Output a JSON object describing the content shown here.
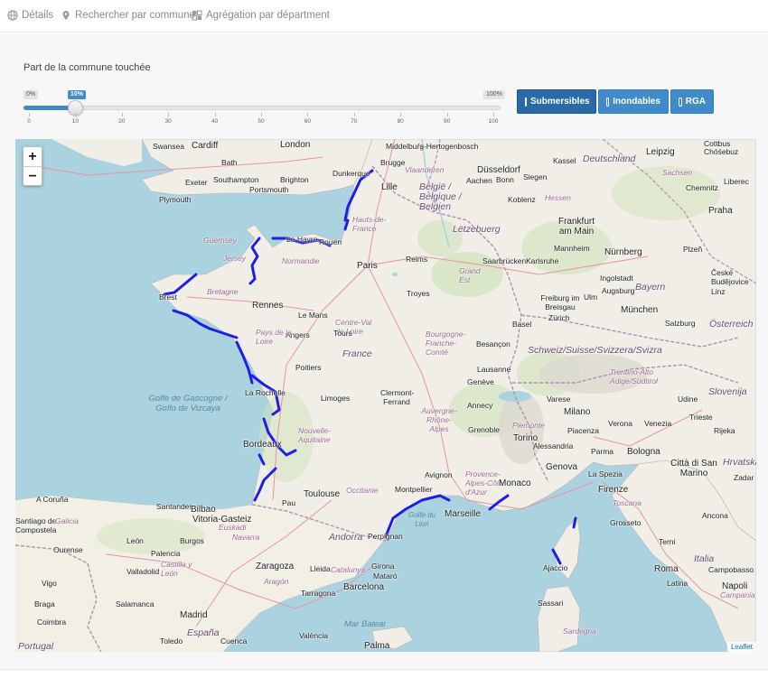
{
  "nav": {
    "tabs": [
      {
        "label": "Détails",
        "icon": "globe-icon"
      },
      {
        "label": "Rechercher par commune",
        "icon": "map-marker-icon"
      },
      {
        "label": "Agrégation par départment",
        "icon": "grid-icon"
      }
    ]
  },
  "slider": {
    "label": "Part de la commune touchée",
    "min_label": "0%",
    "max_label": "100%",
    "current_label": "10%",
    "value_percent": 10,
    "ticks": [
      "0",
      "10",
      "20",
      "30",
      "40",
      "50",
      "60",
      "70",
      "80",
      "90",
      "100"
    ]
  },
  "toggles": [
    {
      "label": "Submersibles",
      "checked": true
    },
    {
      "label": "Inondables",
      "checked": false
    },
    {
      "label": "RGA",
      "checked": false
    }
  ],
  "map": {
    "zoom_in": "+",
    "zoom_out": "−",
    "attribution": "Leaflet",
    "labels": {
      "swansea": "Swansea",
      "cardiff": "Cardiff",
      "london": "London",
      "bath": "Bath",
      "exeter": "Exeter",
      "southampton": "Southampton",
      "portsmouth": "Portsmouth",
      "brighton": "Brighton",
      "plymouth": "Plymouth",
      "middelburg": "Middelburg",
      "hertogenbosch": "'s-Hertogenbosch",
      "brugge": "Brugge",
      "vlaanderen": "Vlaanderen",
      "dunkerque": "Dunkerque",
      "lille": "Lille",
      "belgique": "België / Belgique / Belgien",
      "dusseldorf": "Düsseldorf",
      "aachen": "Aachen",
      "bonn": "Bonn",
      "siegen": "Siegen",
      "koblenz": "Koblenz",
      "kassel": "Kassel",
      "deutschland": "Deutschland",
      "leipzig": "Leipzig",
      "cottbus": "Cottbus Chóśebuz",
      "sachsen": "Sachsen",
      "chemnitz": "Chemnitz",
      "liberec": "Liberec",
      "frankfurt": "Frankfurt am Main",
      "hessen": "Hessen",
      "praha": "Praha",
      "letzebuerg": "Lëtzebuerg",
      "mannheim": "Mannheim",
      "nurnberg": "Nürnberg",
      "plzen": "Plzeň",
      "saarbrucken": "Saarbrücken",
      "karlsruhe": "Karlsruhe",
      "guernsey": "Guernsey",
      "jersey": "Jersey",
      "lehavre": "Le Havre",
      "rouen": "Rouen",
      "hautsdefrance": "Hauts-de-France",
      "normandie": "Normandie",
      "paris": "Paris",
      "reims": "Reims",
      "ingolstadt": "Ingolstadt",
      "bayern": "Bayern",
      "ceske": "České Budějovice",
      "brest": "Brest",
      "bretagne": "Bretagne",
      "rennes": "Rennes",
      "lemans": "Le Mans",
      "troyes": "Troyes",
      "grandest": "Grand Est",
      "freiburg": "Freiburg im Breisgau",
      "ulm": "Ulm",
      "augsburg": "Augsburg",
      "munchen": "München",
      "linz": "Linz",
      "angers": "Angers",
      "centre": "Centre-Val de Loire",
      "paysdelaloire": "Pays de la Loire",
      "basel": "Basel",
      "zurich": "Zürich",
      "salzburg": "Salzburg",
      "osterreich": "Österreich",
      "tours": "Tours",
      "bourgogne": "Bourgogne-Franche-Comté",
      "besancon": "Besançon",
      "france": "France",
      "schweiz": "Schweiz/Suisse/Svizzera/Svizra",
      "poitiers": "Poitiers",
      "lausanne": "Lausanne",
      "trentino": "Trentino-Alto Adige/Südtirol",
      "golfe": "Golfe de Gascogne / Golfo de Vizcaya",
      "larochelle": "La Rochelle",
      "limoges": "Limoges",
      "clermont": "Clermont-Ferrand",
      "geneve": "Genève",
      "varese": "Varese",
      "udine": "Udine",
      "slovenija": "Slovenija",
      "annecy": "Annecy",
      "auvergne": "Auvergne-Rhône-Alpes",
      "milano": "Milano",
      "verona": "Verona",
      "venezia": "Venezia",
      "trieste": "Trieste",
      "nouvelleaquitaine": "Nouvelle-Aquitaine",
      "grenoble": "Grenoble",
      "piemonte": "Piemonte",
      "torino": "Torino",
      "piacenza": "Piacenza",
      "rijeka": "Rijeka",
      "bordeaux": "Bordeaux",
      "alessandria": "Alessandria",
      "parma": "Parma",
      "bologna": "Bologna",
      "hrvatska": "Hrvatska",
      "avignon": "Avignon",
      "provence": "Provence-Alpes-Côte d'Azur",
      "genova": "Genova",
      "lasperzia": "La Spezia",
      "cittasanmarino": "Città di San Marino",
      "zadar": "Zadar",
      "acoruna": "A Coruña",
      "pau": "Pau",
      "toulouse": "Toulouse",
      "occitanie": "Occitanie",
      "montpellier": "Montpellier",
      "monaco": "Monaco",
      "firenze": "Firenze",
      "toscana": "Toscana",
      "santiago": "Santiago de Compostela",
      "galicia": "Galicia",
      "santander": "Santander",
      "bilbao": "Bilbao",
      "vitoria": "Vitoria-Gasteiz",
      "marseille": "Marseille",
      "golfedulion": "Golfe du Lion",
      "grosseto": "Grosseto",
      "ancona": "Ancona",
      "euskadi": "Euskadi",
      "navarra": "Navarra",
      "andorra": "Andorra",
      "perpignan": "Perpignan",
      "terni": "Terni",
      "leon": "León",
      "burgos": "Burgos",
      "ourense": "Ourense",
      "palencia": "Palencia",
      "castilla": "Castilla y León",
      "zaragoza": "Zaragoza",
      "lleida": "Lleida",
      "catalunya": "Catalunya",
      "girona": "Girona",
      "ajaccio": "Ajaccio",
      "italia": "Italia",
      "roma": "Roma",
      "campobasso": "Campobasso",
      "vigo": "Vigo",
      "valladolid": "Valladolid",
      "aragon": "Aragón",
      "mataro": "Mataró",
      "barcelona": "Barcelona",
      "tarragona": "Tarragona",
      "latina": "Latina",
      "napoli": "Napoli",
      "braga": "Braga",
      "salamanca": "Salamanca",
      "sassari": "Sassari",
      "campania": "Campania",
      "madrid": "Madrid",
      "marbalear": "Mar Balear",
      "coimbra": "Coimbra",
      "espana": "España",
      "toledo": "Toledo",
      "cuenca": "Cuenca",
      "sardegna": "Sardegna",
      "valencia": "València",
      "palma": "Palma",
      "portugal": "Portugal"
    }
  }
}
